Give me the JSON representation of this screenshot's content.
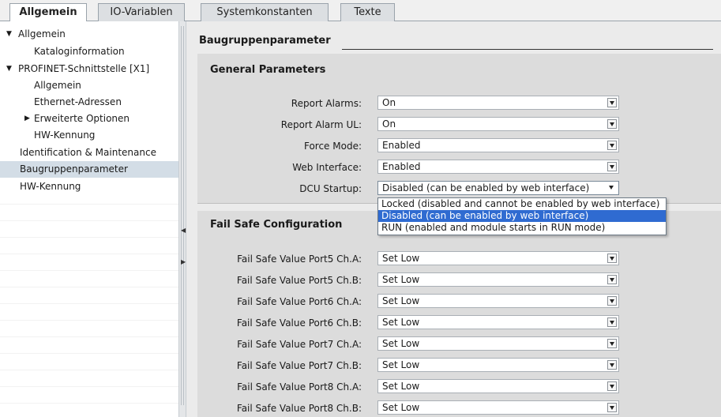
{
  "tabs": [
    {
      "label": "Allgemein",
      "active": true
    },
    {
      "label": "IO-Variablen",
      "active": false
    },
    {
      "label": "Systemkonstanten",
      "active": false
    },
    {
      "label": "Texte",
      "active": false
    }
  ],
  "nav": [
    {
      "label": "Allgemein",
      "arrow": "▼",
      "level": 0
    },
    {
      "label": "Kataloginformation",
      "arrow": "",
      "level": 2
    },
    {
      "label": "PROFINET-Schnittstelle [X1]",
      "arrow": "▼",
      "level": 0
    },
    {
      "label": "Allgemein",
      "arrow": "",
      "level": 2
    },
    {
      "label": "Ethernet-Adressen",
      "arrow": "",
      "level": 2
    },
    {
      "label": "Erweiterte Optionen",
      "arrow": "▶",
      "level": 1
    },
    {
      "label": "HW-Kennung",
      "arrow": "",
      "level": 2
    },
    {
      "label": "Identification & Maintenance",
      "arrow": "",
      "level": 3
    },
    {
      "label": "Baugruppenparameter",
      "arrow": "",
      "level": 3,
      "selected": true
    },
    {
      "label": "HW-Kennung",
      "arrow": "",
      "level": 3
    }
  ],
  "section_title": "Baugruppenparameter",
  "general": {
    "title": "General Parameters",
    "rows": [
      {
        "label": "Report Alarms:",
        "value": "On"
      },
      {
        "label": "Report Alarm UL:",
        "value": "On"
      },
      {
        "label": "Force Mode:",
        "value": "Enabled"
      },
      {
        "label": "Web Interface:",
        "value": "Enabled"
      },
      {
        "label": "DCU Startup:",
        "value": "Disabled (can be enabled by web interface)",
        "open": true
      }
    ]
  },
  "dropdown_options": [
    {
      "label": "Locked (disabled and cannot be enabled by web interface)",
      "highlighted": false
    },
    {
      "label": "Disabled (can be enabled by web interface)",
      "highlighted": true
    },
    {
      "label": "RUN (enabled and module starts in RUN mode)",
      "highlighted": false
    }
  ],
  "failsafe": {
    "title": "Fail Safe Configuration",
    "rows": [
      {
        "label": "Fail Safe Value Port5 Ch.A:",
        "value": "Set Low"
      },
      {
        "label": "Fail Safe Value Port5 Ch.B:",
        "value": "Set Low"
      },
      {
        "label": "Fail Safe Value Port6 Ch.A:",
        "value": "Set Low"
      },
      {
        "label": "Fail Safe Value Port6 Ch.B:",
        "value": "Set Low"
      },
      {
        "label": "Fail Safe Value Port7 Ch.A:",
        "value": "Set Low"
      },
      {
        "label": "Fail Safe Value Port7 Ch.B:",
        "value": "Set Low"
      },
      {
        "label": "Fail Safe Value Port8 Ch.A:",
        "value": "Set Low"
      },
      {
        "label": "Fail Safe Value Port8 Ch.B:",
        "value": "Set Low"
      }
    ]
  },
  "splitter": {
    "up_glyph": "◀",
    "down_glyph": "▶"
  },
  "colors": {
    "selection": "#2f6bd1",
    "nav_selected": "#d3dde6"
  }
}
